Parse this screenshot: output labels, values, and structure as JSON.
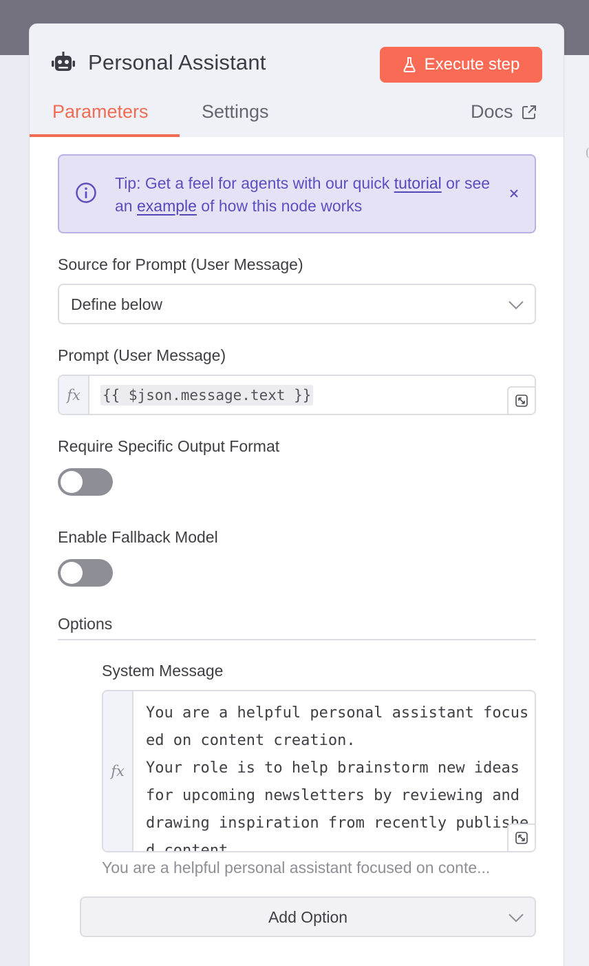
{
  "panel": {
    "title": "Personal Assistant",
    "execute_label": "Execute step"
  },
  "tabs": {
    "parameters": "Parameters",
    "settings": "Settings",
    "docs": "Docs"
  },
  "tip": {
    "prefix": "Tip: Get a feel for agents with our quick ",
    "link1": "tutorial",
    "middle": " or see an ",
    "link2": "example",
    "suffix": " of how this node works"
  },
  "source_prompt": {
    "label": "Source for Prompt (User Message)",
    "value": "Define below"
  },
  "prompt": {
    "label": "Prompt (User Message)",
    "fx": "fx",
    "value": "{{ $json.message.text }}"
  },
  "output_format": {
    "label": "Require Specific Output Format",
    "enabled": false
  },
  "fallback_model": {
    "label": "Enable Fallback Model",
    "enabled": false
  },
  "options": {
    "label": "Options",
    "system_message": {
      "label": "System Message",
      "fx": "fx",
      "value": "You are a helpful personal assistant focused on content creation.\nYour role is to help brainstorm new ideas for upcoming newsletters by reviewing and drawing inspiration from recently published content.",
      "hint": "You are a helpful personal assistant focused on conte..."
    },
    "add_option_label": "Add Option"
  },
  "colors": {
    "accent": "#f26c53",
    "execute_button": "#fa6b55",
    "tip_background": "#e5e2f6",
    "tip_text": "#5c4fc0",
    "toggle_off": "#8e8e96"
  }
}
